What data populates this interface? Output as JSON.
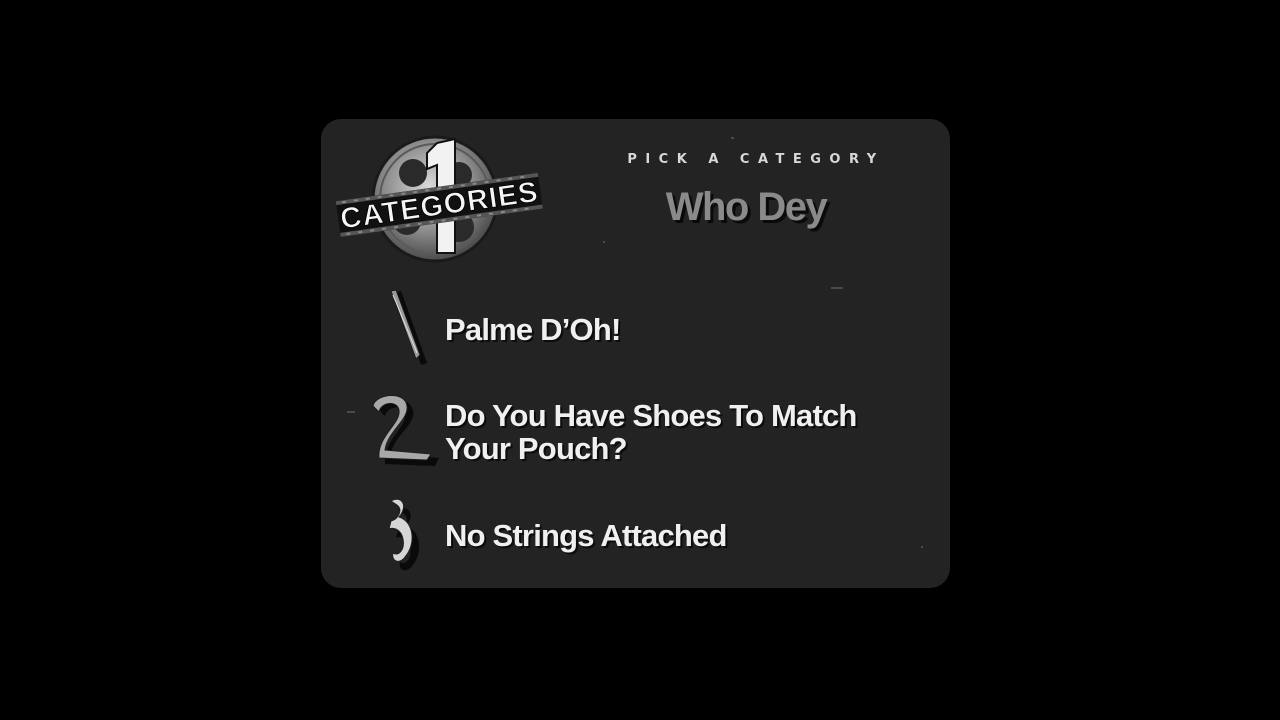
{
  "logo": {
    "text": "CATEGORIES",
    "numeral": "1"
  },
  "header": {
    "label": "PICK A CATEGORY",
    "player_name": "Who Dey"
  },
  "options": [
    {
      "number": "1",
      "label": "Palme D’Oh!"
    },
    {
      "number": "2",
      "label": "Do You Have Shoes To Match Your Pouch?"
    },
    {
      "number": "3",
      "label": "No Strings Attached"
    }
  ],
  "colors": {
    "background": "#000000",
    "panel": "#232323",
    "option_text": "#f0f0f0",
    "player_name": "#8a8a8a",
    "header_label": "#d8d8d8"
  }
}
